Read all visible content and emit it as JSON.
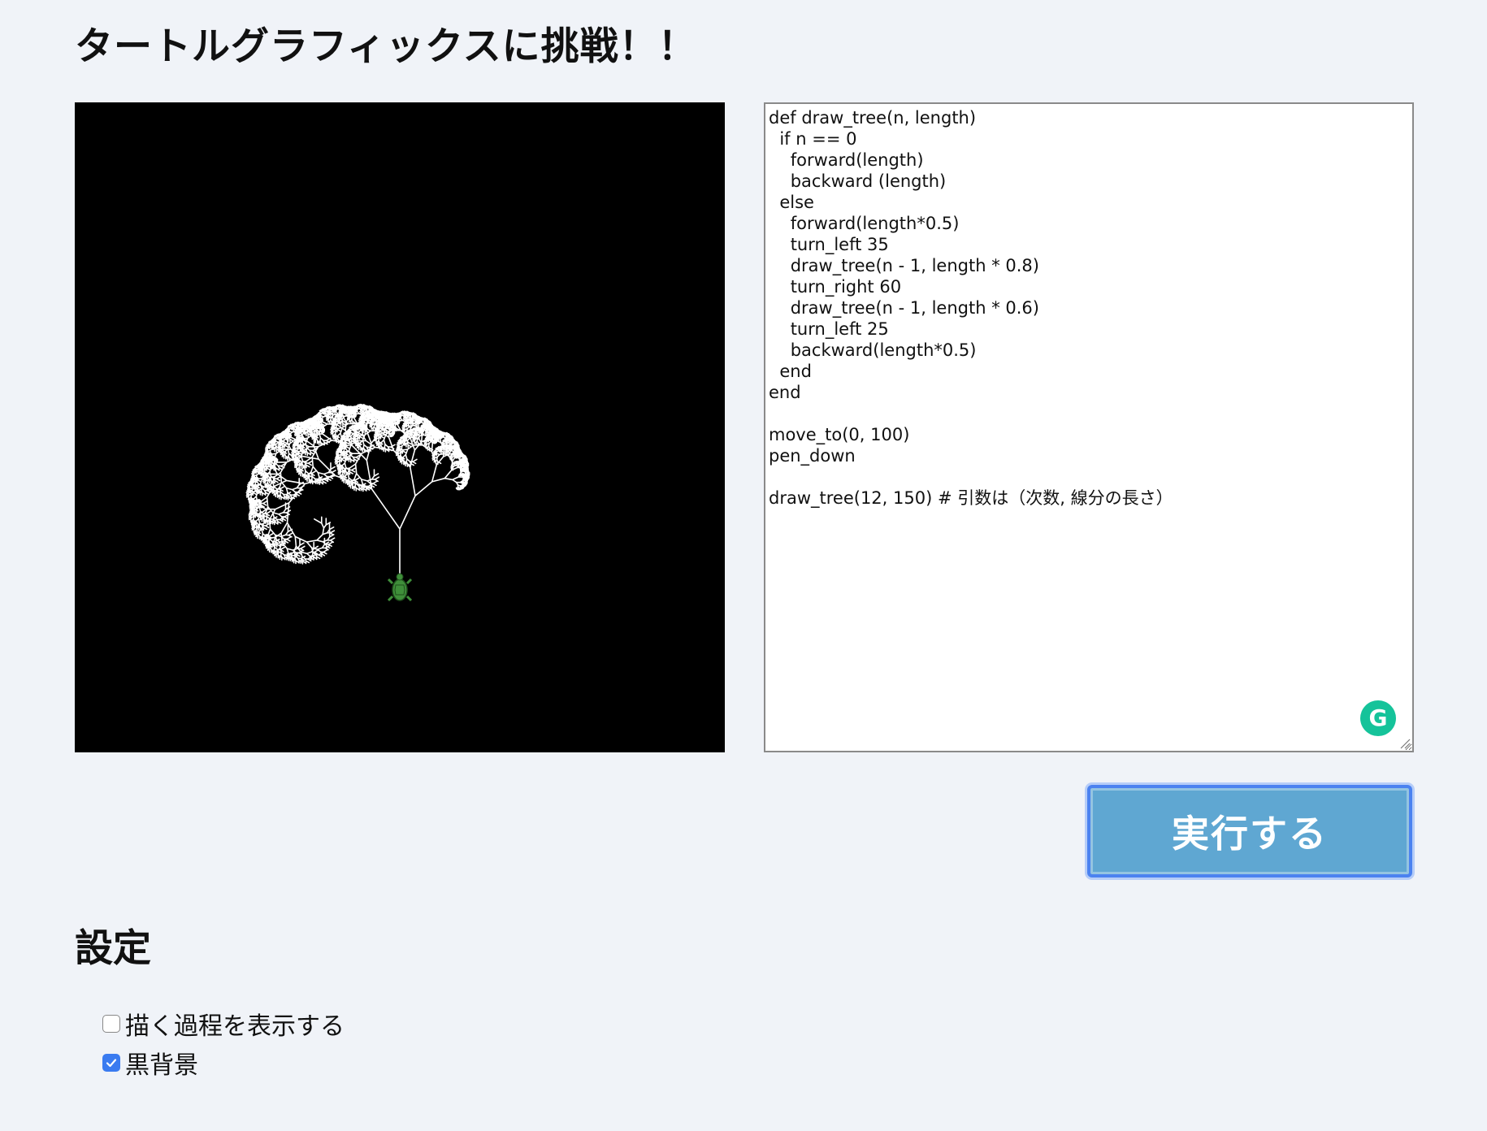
{
  "page": {
    "title": "タートルグラフィックスに挑戦！！"
  },
  "canvas": {
    "background": "#000000",
    "line_color": "#ffffff",
    "turtle_color": "#3f8f3a",
    "turtle_icon": "turtle-icon"
  },
  "editor": {
    "code": "def draw_tree(n, length)\n  if n == 0\n    forward(length)\n    backward (length)\n  else\n    forward(length*0.5)\n    turn_left 35\n    draw_tree(n - 1, length * 0.8)\n    turn_right 60\n    draw_tree(n - 1, length * 0.6)\n    turn_left 25\n    backward(length*0.5)\n  end\nend\n\nmove_to(0, 100)\npen_down\n\ndraw_tree(12, 150) # 引数は（次数, 線分の長さ）",
    "grammarly_badge": "G",
    "grammarly_color": "#15c39a"
  },
  "run_button": {
    "label": "実行する",
    "color": "#5fa7d2"
  },
  "settings": {
    "title": "設定",
    "options": [
      {
        "label": "描く過程を表示する",
        "checked": false
      },
      {
        "label": "黒背景",
        "checked": true
      }
    ]
  }
}
